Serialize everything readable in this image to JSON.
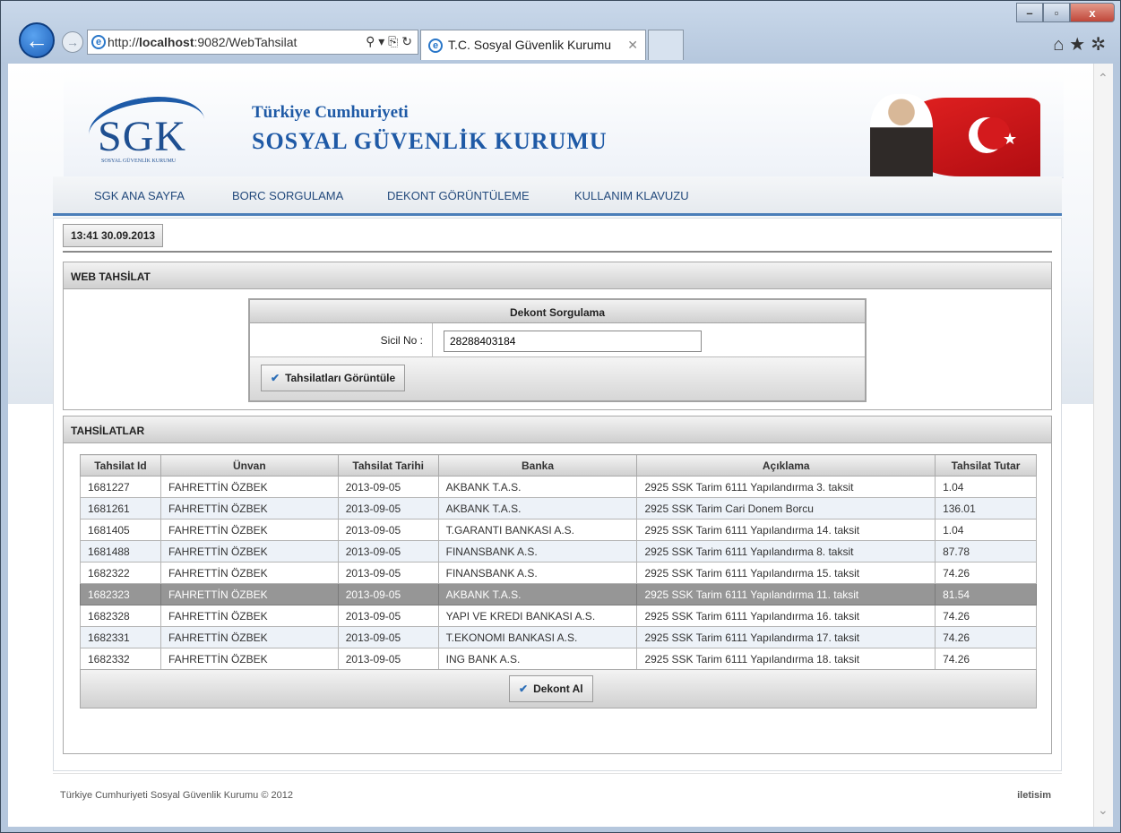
{
  "browser": {
    "url_prefix": "http://",
    "url_host": "localhost",
    "url_rest": ":9082/WebTahsilat",
    "addr_controls": "⚲ ▾ ⎘ ↻",
    "tab_title": "T.C. Sosyal Güvenlik Kurumu",
    "tab_close": "✕",
    "minimize": "–",
    "maximize": "▫",
    "close": "x",
    "tools": "⌂★✲"
  },
  "header": {
    "logo_text": "SGK",
    "logo_small": "SOSYAL GÜVENLİK KURUMU",
    "line1": "Türkiye Cumhuriyeti",
    "line2": "SOSYAL GÜVENLİK KURUMU"
  },
  "nav": {
    "items": [
      "SGK ANA SAYFA",
      "BORC SORGULAMA",
      "DEKONT GÖRÜNTÜLEME",
      "KULLANIM KLAVUZU"
    ]
  },
  "clock": "13:41 30.09.2013",
  "web_tahsilat": {
    "title": "WEB TAHSİLAT",
    "form_title": "Dekont Sorgulama",
    "sicil_label": "Sicil No :",
    "sicil_value": "28288403184",
    "button": "Tahsilatları Görüntüle"
  },
  "tahsilatlar": {
    "title": "TAHSİLATLAR",
    "columns": [
      "Tahsilat Id",
      "Ünvan",
      "Tahsilat Tarihi",
      "Banka",
      "Açıklama",
      "Tahsilat Tutar"
    ],
    "rows": [
      [
        "1681227",
        "FAHRETTİN ÖZBEK",
        "2013-09-05",
        "AKBANK T.A.S.",
        "2925 SSK Tarim 6111 Yapılandırma 3. taksit",
        "1.04"
      ],
      [
        "1681261",
        "FAHRETTİN ÖZBEK",
        "2013-09-05",
        "AKBANK T.A.S.",
        "2925 SSK Tarim Cari Donem Borcu",
        "136.01"
      ],
      [
        "1681405",
        "FAHRETTİN ÖZBEK",
        "2013-09-05",
        "T.GARANTI BANKASI A.S.",
        "2925 SSK Tarim 6111 Yapılandırma 14. taksit",
        "1.04"
      ],
      [
        "1681488",
        "FAHRETTİN ÖZBEK",
        "2013-09-05",
        "FINANSBANK A.S.",
        "2925 SSK Tarim 6111 Yapılandırma 8. taksit",
        "87.78"
      ],
      [
        "1682322",
        "FAHRETTİN ÖZBEK",
        "2013-09-05",
        "FINANSBANK A.S.",
        "2925 SSK Tarim 6111 Yapılandırma 15. taksit",
        "74.26"
      ],
      [
        "1682323",
        "FAHRETTİN ÖZBEK",
        "2013-09-05",
        "AKBANK T.A.S.",
        "2925 SSK Tarim 6111 Yapılandırma 11. taksit",
        "81.54"
      ],
      [
        "1682328",
        "FAHRETTİN ÖZBEK",
        "2013-09-05",
        "YAPI VE KREDI BANKASI A.S.",
        "2925 SSK Tarim 6111 Yapılandırma 16. taksit",
        "74.26"
      ],
      [
        "1682331",
        "FAHRETTİN ÖZBEK",
        "2013-09-05",
        "T.EKONOMI BANKASI A.S.",
        "2925 SSK Tarim 6111 Yapılandırma 17. taksit",
        "74.26"
      ],
      [
        "1682332",
        "FAHRETTİN ÖZBEK",
        "2013-09-05",
        "ING BANK A.S.",
        "2925 SSK Tarim 6111 Yapılandırma 18. taksit",
        "74.26"
      ]
    ],
    "selected_index": 5,
    "button": "Dekont Al"
  },
  "footer": {
    "copyright": "Türkiye Cumhuriyeti Sosyal Güvenlik Kurumu © 2012",
    "contact": "iletisim"
  }
}
